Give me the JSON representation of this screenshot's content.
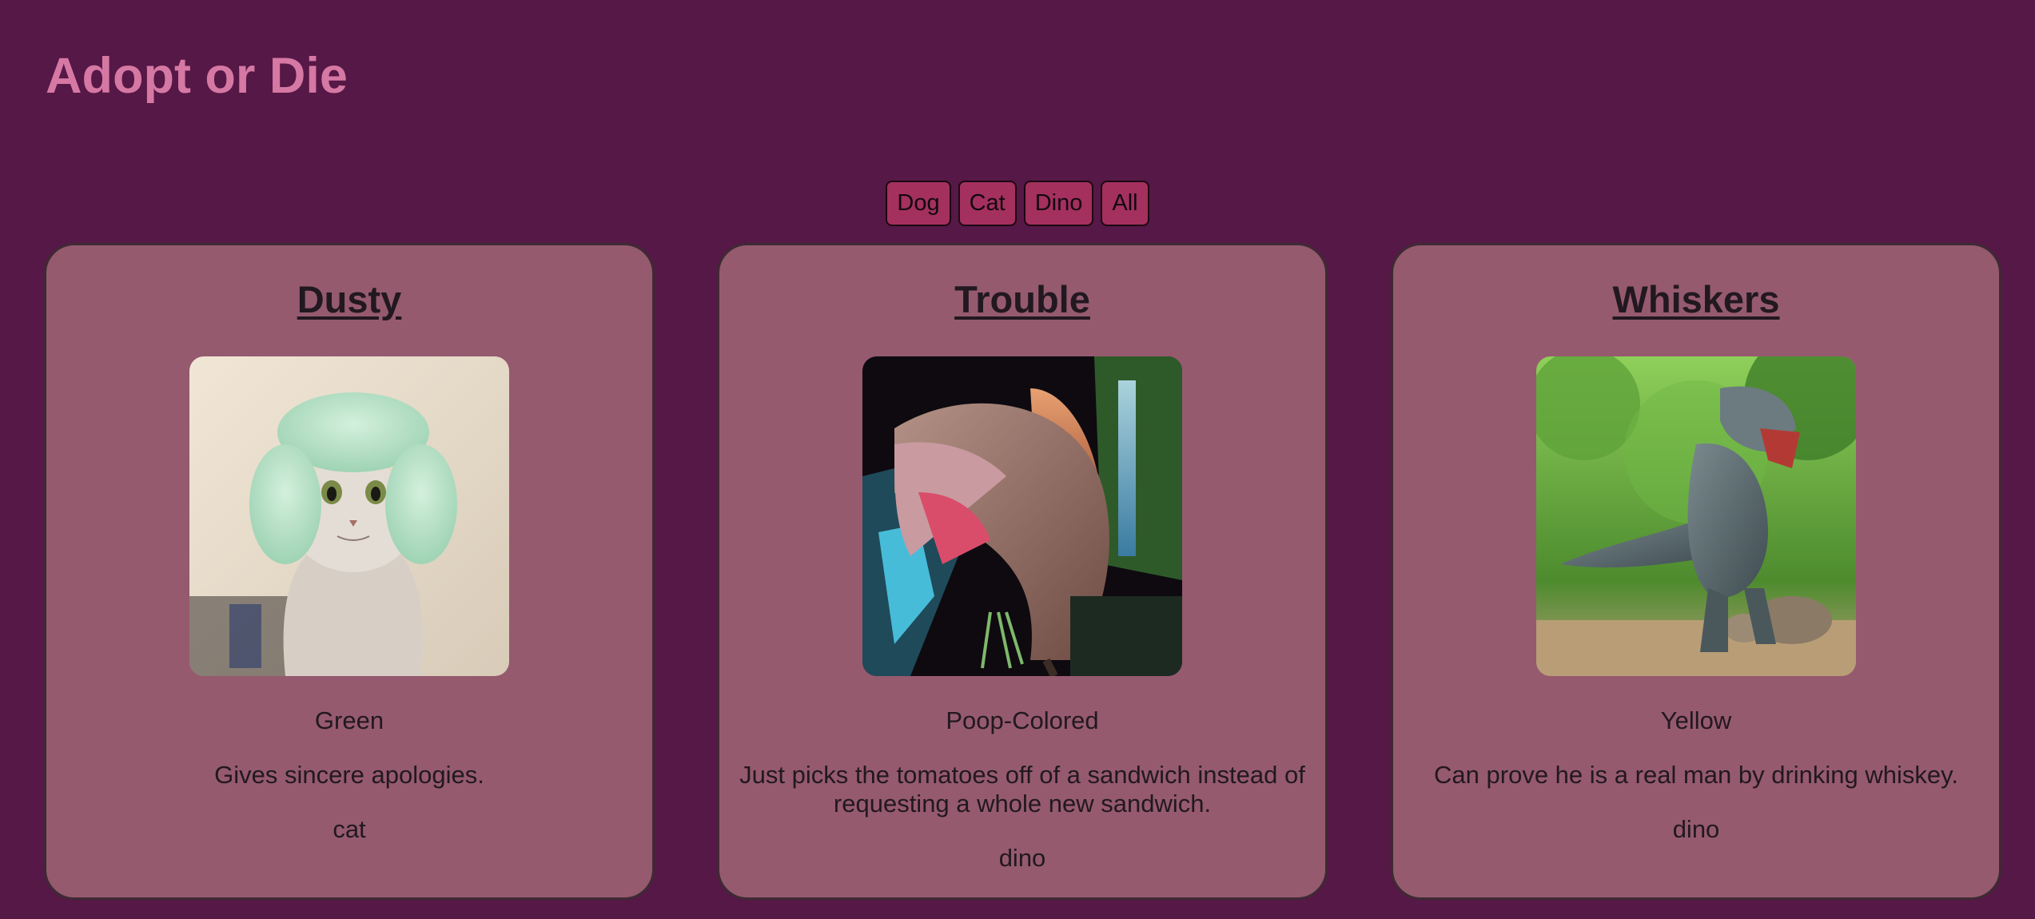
{
  "site": {
    "title": "Adopt or Die"
  },
  "filters": [
    {
      "label": "Dog"
    },
    {
      "label": "Cat"
    },
    {
      "label": "Dino"
    },
    {
      "label": "All"
    }
  ],
  "pets": [
    {
      "name": "Dusty",
      "photo": "cat-wearing-towel-photo",
      "color": "Green",
      "description": "Gives sincere apologies.",
      "species": "cat"
    },
    {
      "name": "Trouble",
      "photo": "spinosaurus-photo",
      "color": "Poop-Colored",
      "description": "Just picks the tomatoes off of a sandwich instead of requesting a whole new sandwich.",
      "species": "dino"
    },
    {
      "name": "Whiskers",
      "photo": "t-rex-in-forest-photo",
      "color": "Yellow",
      "description": "Can prove he is a real man by drinking whiskey.",
      "species": "dino"
    }
  ],
  "colors": {
    "background": "#561846",
    "title": "#d678a4",
    "button": "#a4305e",
    "card": "#955a6e"
  }
}
